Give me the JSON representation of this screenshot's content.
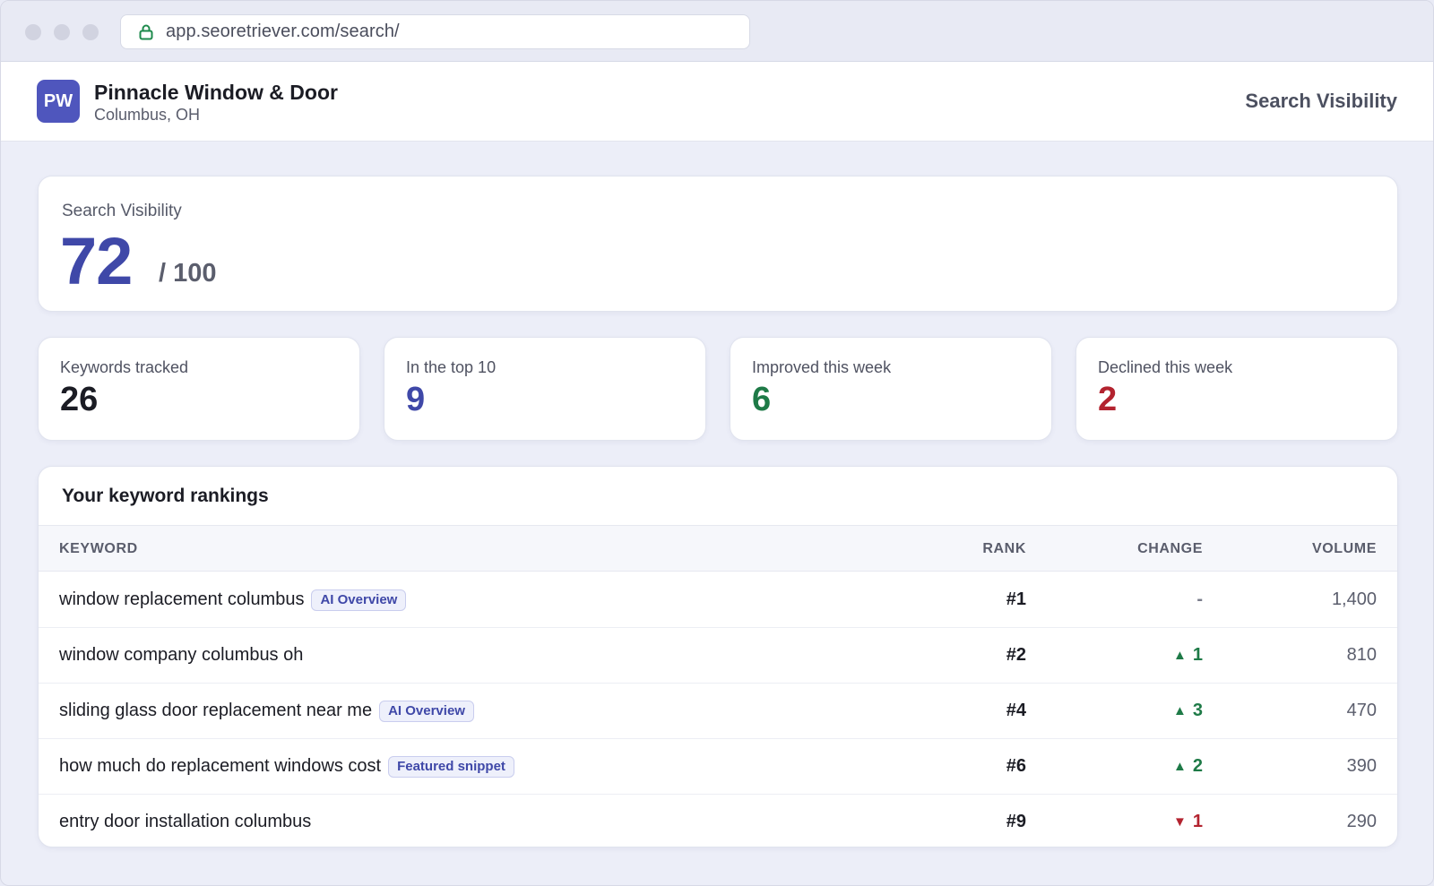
{
  "browser": {
    "url": "app.seoretriever.com/search/"
  },
  "header": {
    "logo_initials": "PW",
    "business_name": "Pinnacle Window & Door",
    "location": "Columbus, OH",
    "page_title": "Search Visibility"
  },
  "visibility": {
    "label": "Search Visibility",
    "score": "72",
    "max": "/ 100"
  },
  "stats": [
    {
      "label": "Keywords tracked",
      "value": "26",
      "color": "#1b1c24"
    },
    {
      "label": "In the top 10",
      "value": "9",
      "color": "#3f48a8"
    },
    {
      "label": "Improved this week",
      "value": "6",
      "color": "#1e7a47"
    },
    {
      "label": "Declined this week",
      "value": "2",
      "color": "#b3232f"
    }
  ],
  "rankings": {
    "title": "Your keyword rankings",
    "columns": {
      "keyword": "KEYWORD",
      "rank": "RANK",
      "change": "CHANGE",
      "volume": "VOLUME"
    },
    "rows": [
      {
        "keyword": "window replacement columbus",
        "badge": "AI Overview",
        "rank": "#1",
        "change": "-",
        "direction": "none",
        "volume": "1,400"
      },
      {
        "keyword": "window company columbus oh",
        "badge": "",
        "rank": "#2",
        "change": "1",
        "direction": "up",
        "volume": "810"
      },
      {
        "keyword": "sliding glass door replacement near me",
        "badge": "AI Overview",
        "rank": "#4",
        "change": "3",
        "direction": "up",
        "volume": "470"
      },
      {
        "keyword": "how much do replacement windows cost",
        "badge": "Featured snippet",
        "rank": "#6",
        "change": "2",
        "direction": "up",
        "volume": "390"
      },
      {
        "keyword": "entry door installation columbus",
        "badge": "",
        "rank": "#9",
        "change": "1",
        "direction": "down",
        "volume": "290"
      }
    ]
  },
  "icons": {
    "lock": "lock-icon",
    "up_arrow": "▲",
    "down_arrow": "▼"
  },
  "colors": {
    "accent": "#3f48a8",
    "positive": "#1e7a47",
    "negative": "#b3232f",
    "secure_lock": "#1e8a4c"
  }
}
